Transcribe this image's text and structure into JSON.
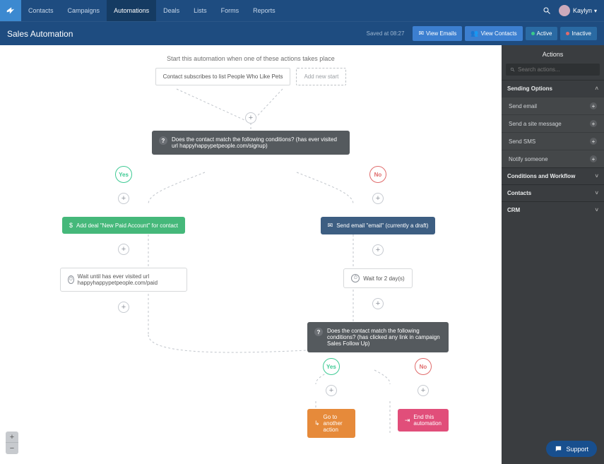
{
  "topnav": {
    "items": [
      "Contacts",
      "Campaigns",
      "Automations",
      "Deals",
      "Lists",
      "Forms",
      "Reports"
    ],
    "active_index": 2,
    "user_name": "Kaylyn"
  },
  "subbar": {
    "title": "Sales Automation",
    "saved": "Saved at 08:27",
    "buttons": {
      "view_emails": "View Emails",
      "view_contacts": "View Contacts",
      "active": "Active",
      "inactive": "Inactive"
    }
  },
  "flow": {
    "hint": "Start this automation when one of these actions takes place",
    "trigger": "Contact subscribes to list People Who Like Pets",
    "add_trigger": "Add new start",
    "cond1": "Does the contact match the following conditions? (has ever visited url happyhappypetpeople.com/signup)",
    "yes_label": "Yes",
    "no_label": "No",
    "add_deal": "Add deal \"New Paid Account\" for contact",
    "wait_visit": "Wait until has ever visited url happyhappypetpeople.com/paid",
    "send_email": "Send email \"email\" (currently a draft)",
    "wait_days": "Wait for 2 day(s)",
    "cond2": "Does the contact match the following conditions? (has clicked any link in campaign Sales Follow Up)",
    "goto": "Go to another action",
    "end": "End this automation"
  },
  "sidebar": {
    "title": "Actions",
    "search_placeholder": "Search actions...",
    "groups": {
      "sending": {
        "label": "Sending Options",
        "items": [
          "Send email",
          "Send a site message",
          "Send SMS",
          "Notify someone"
        ]
      },
      "conditions": {
        "label": "Conditions and Workflow"
      },
      "contacts": {
        "label": "Contacts"
      },
      "crm": {
        "label": "CRM"
      }
    }
  },
  "support": "Support"
}
